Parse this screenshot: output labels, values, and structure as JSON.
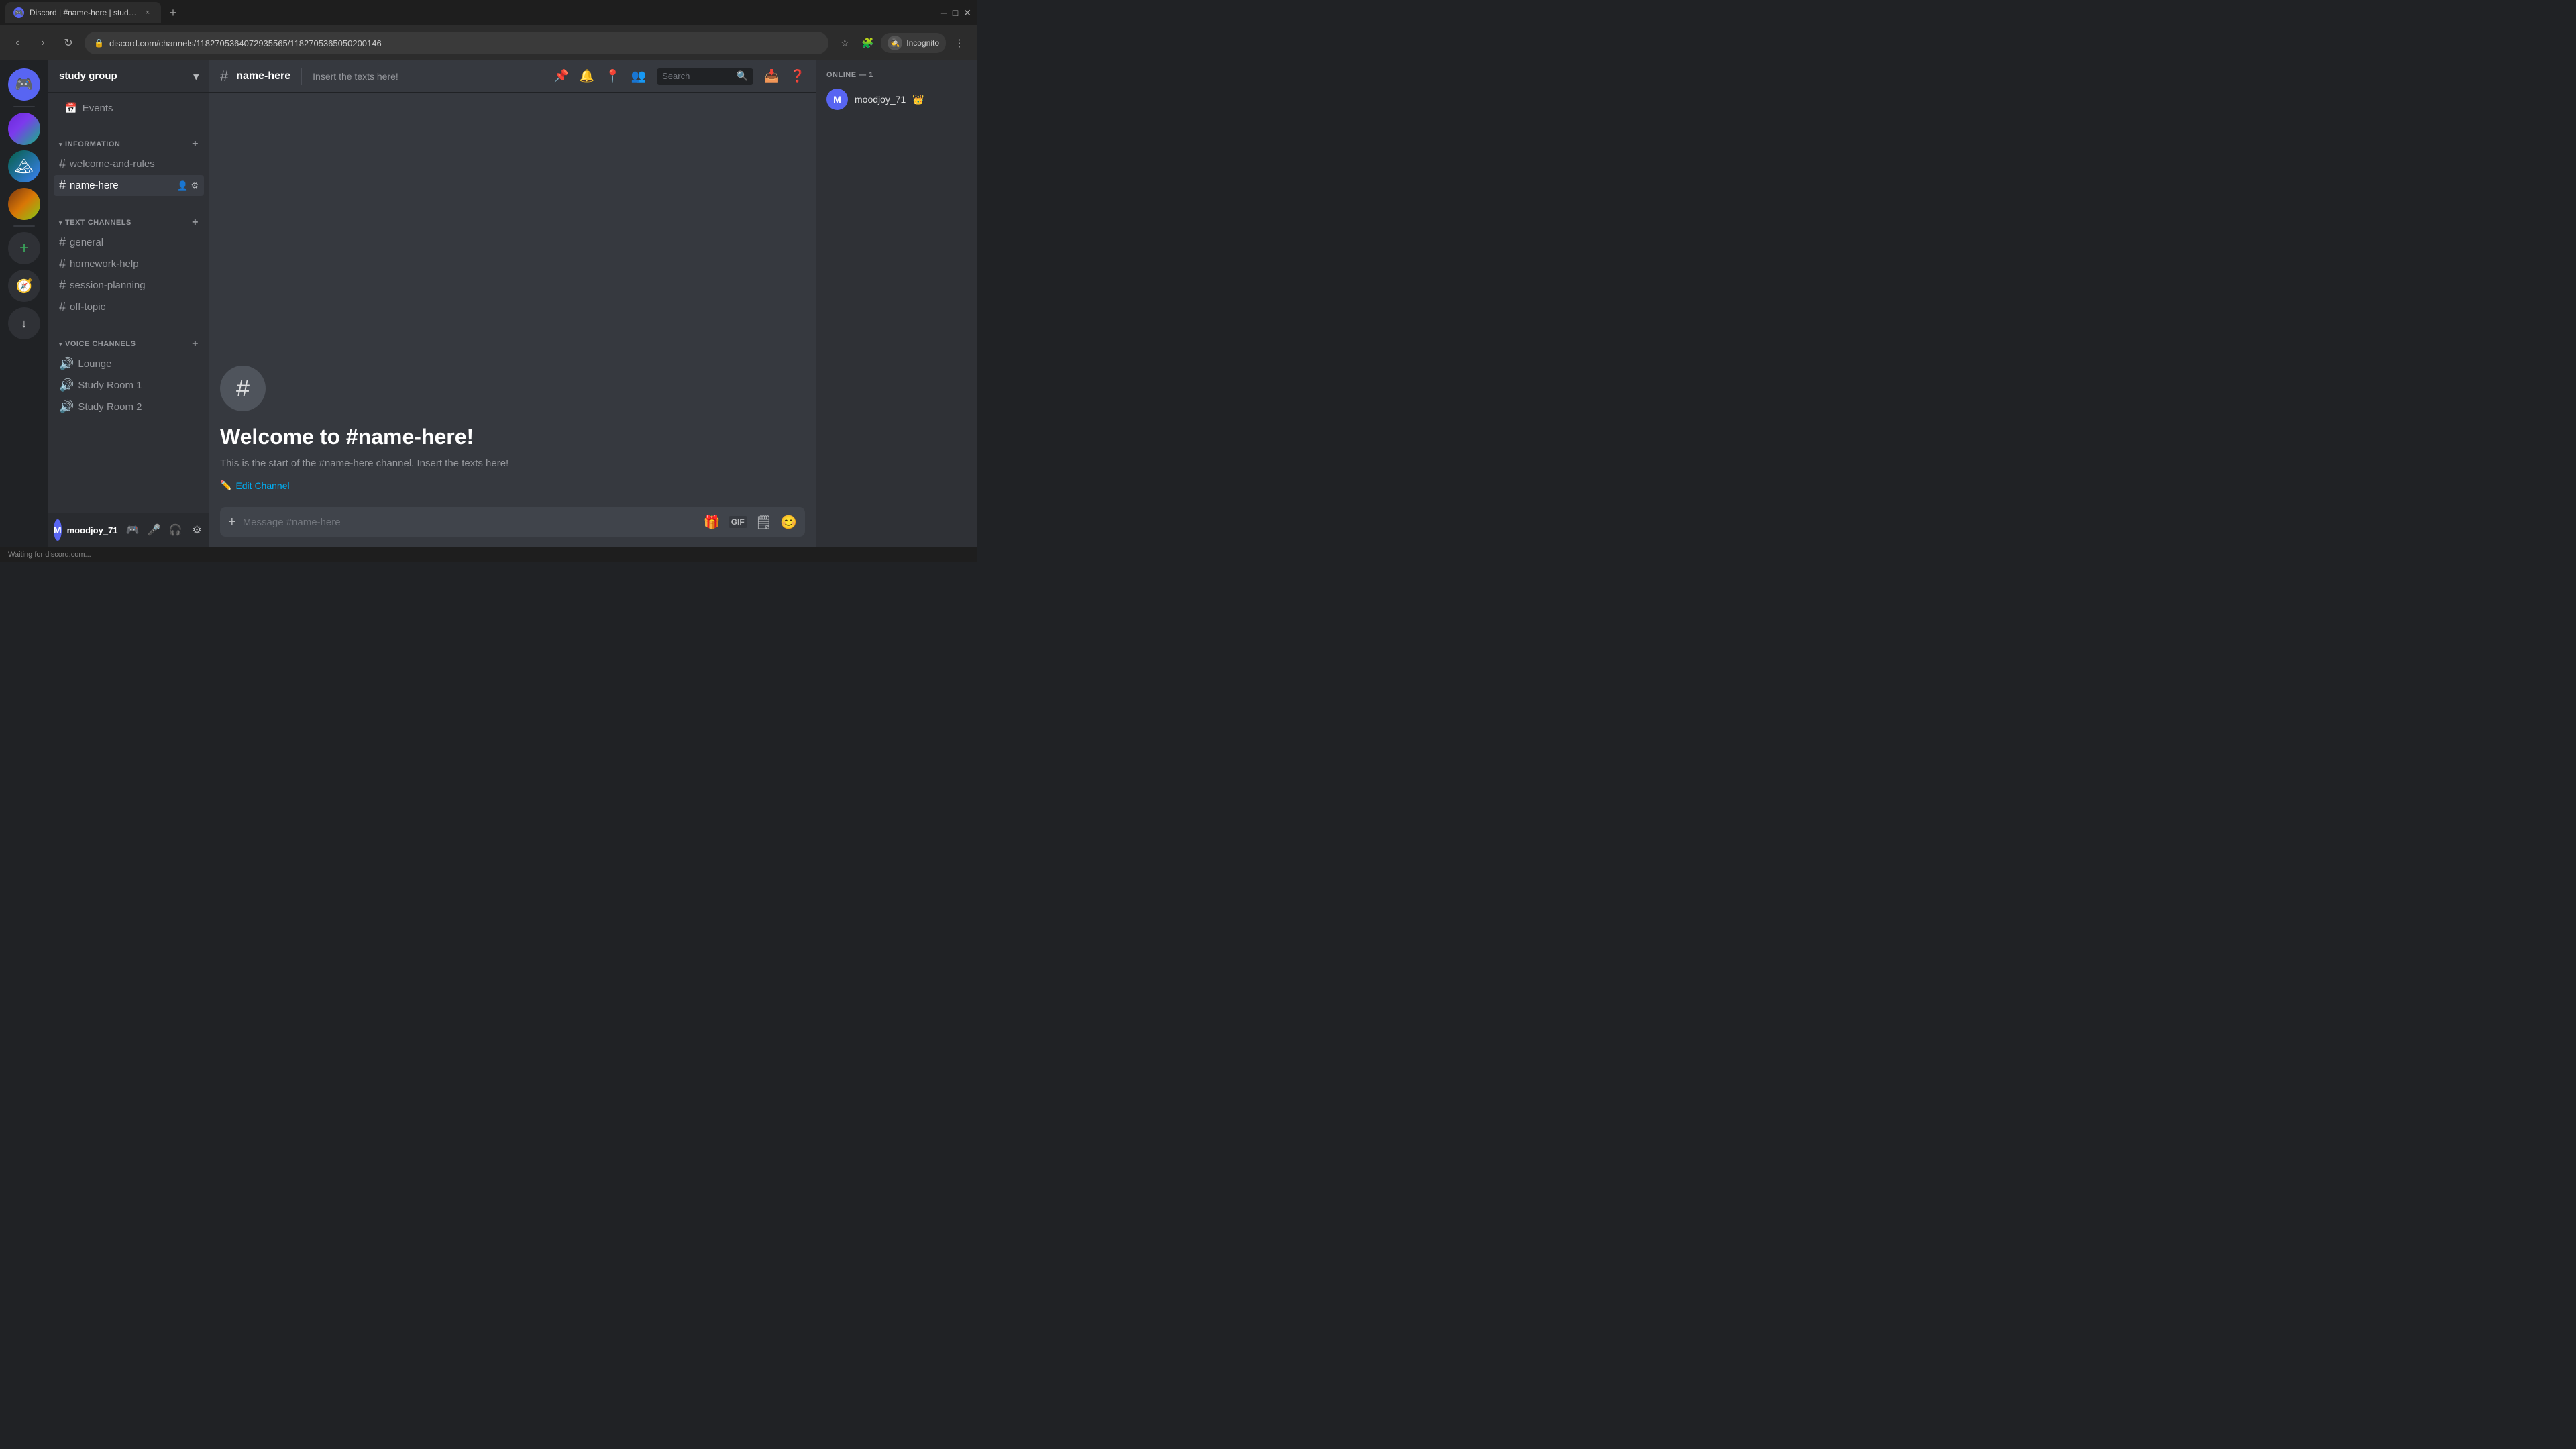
{
  "browser": {
    "tab_favicon": "D",
    "tab_title": "Discord | #name-here | study gr...",
    "tab_close": "×",
    "tab_new": "+",
    "nav_back": "‹",
    "nav_forward": "›",
    "nav_refresh": "↻",
    "url": "discord.com/channels/1182705364072935565/1182705365050200146",
    "incognito_label": "Incognito",
    "status_bar": "Waiting for discord.com..."
  },
  "server_sidebar": {
    "discord_icon": "🎮",
    "add_server_icon": "+",
    "explore_icon": "🧭",
    "download_icon": "↓"
  },
  "channel_sidebar": {
    "server_name": "study group",
    "events_label": "Events",
    "categories": [
      {
        "name": "INFORMATION",
        "channels": [
          {
            "type": "text",
            "name": "welcome-and-rules"
          },
          {
            "type": "text",
            "name": "name-here",
            "active": true
          }
        ]
      },
      {
        "name": "TEXT CHANNELS",
        "channels": [
          {
            "type": "text",
            "name": "general"
          },
          {
            "type": "text",
            "name": "homework-help"
          },
          {
            "type": "text",
            "name": "session-planning"
          },
          {
            "type": "text",
            "name": "off-topic"
          }
        ]
      },
      {
        "name": "VOICE CHANNELS",
        "channels": [
          {
            "type": "voice",
            "name": "Lounge"
          },
          {
            "type": "voice",
            "name": "Study Room 1"
          },
          {
            "type": "voice",
            "name": "Study Room 2"
          }
        ]
      }
    ],
    "user": {
      "name": "moodjoy_71",
      "status": ""
    }
  },
  "channel_header": {
    "hash": "#",
    "channel_name": "name-here",
    "description": "Insert the texts here!",
    "search_placeholder": "Search",
    "actions": {
      "threads": "📌",
      "notifications": "🔔",
      "pins": "📍",
      "members": "👥",
      "question": "❓"
    }
  },
  "welcome": {
    "hash_symbol": "#",
    "title": "Welcome to #name-here!",
    "description": "This is the start of the #name-here channel. Insert the texts here!",
    "edit_label": "Edit Channel",
    "edit_icon": "✏️"
  },
  "message_input": {
    "placeholder": "Message #name-here",
    "add_icon": "+",
    "gift_icon": "🎁",
    "gif_icon": "GIF",
    "sticker_icon": "🗒",
    "emoji_icon": "😊"
  },
  "members_sidebar": {
    "online_header": "ONLINE — 1",
    "members": [
      {
        "name": "moodjoy_71",
        "crown": true,
        "avatar_letter": "M"
      }
    ]
  }
}
